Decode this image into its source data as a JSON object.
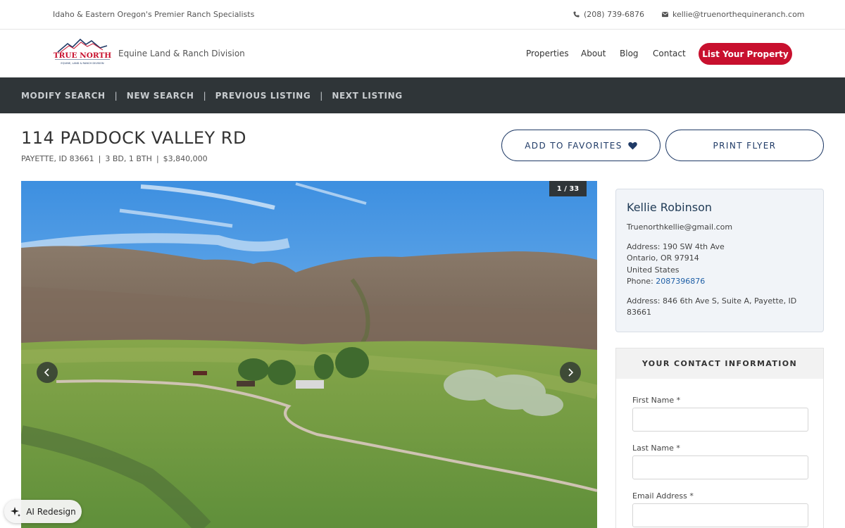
{
  "topbar": {
    "tagline": "Idaho & Eastern Oregon's Premier Ranch Specialists",
    "phone": "(208) 739-6876",
    "email": "kellie@truenorthequineranch.com"
  },
  "header": {
    "logo_text": "TRUE NORTH",
    "logo_subtext": "EQUINE, LAND & RANCH DIVISION",
    "division": "Equine Land & Ranch Division",
    "nav": {
      "properties": "Properties",
      "about": "About",
      "blog": "Blog",
      "contact": "Contact"
    },
    "cta_label": "List Your Property",
    "brand_color": "#c8102e",
    "navy_color": "#1f3a66"
  },
  "searchbar": {
    "modify": "MODIFY SEARCH",
    "new": "NEW SEARCH",
    "previous": "PREVIOUS LISTING",
    "next": "NEXT LISTING",
    "separator": "|"
  },
  "listing": {
    "address": "114 PADDOCK VALLEY RD",
    "location": "PAYETTE, ID  83661",
    "beds_baths": "3 BD, 1 BTH",
    "price": "$3,840,000",
    "pipe": "|",
    "favorites_label": "ADD TO FAVORITES",
    "print_label": "PRINT FLYER"
  },
  "gallery": {
    "counter": "1 / 33",
    "prev_icon": "chevron-left-icon",
    "next_icon": "chevron-right-icon"
  },
  "ai_widget": {
    "label": "AI Redesign",
    "icon": "sparkle-icon"
  },
  "agent": {
    "name": "Kellie Robinson",
    "email": "Truenorthkellie@gmail.com",
    "address_line1": "Address: 190 SW 4th Ave",
    "address_line2": "Ontario, OR 97914",
    "address_line3": "United States",
    "phone_prefix": "Phone: ",
    "phone": "2087396876",
    "office_address": "Address: 846 6th Ave S, Suite A, Payette, ID 83661"
  },
  "contact_form": {
    "heading": "YOUR CONTACT INFORMATION",
    "first_name_label": "First Name *",
    "last_name_label": "Last Name *",
    "email_label": "Email Address *",
    "first_name_value": "",
    "last_name_value": "",
    "email_value": ""
  }
}
